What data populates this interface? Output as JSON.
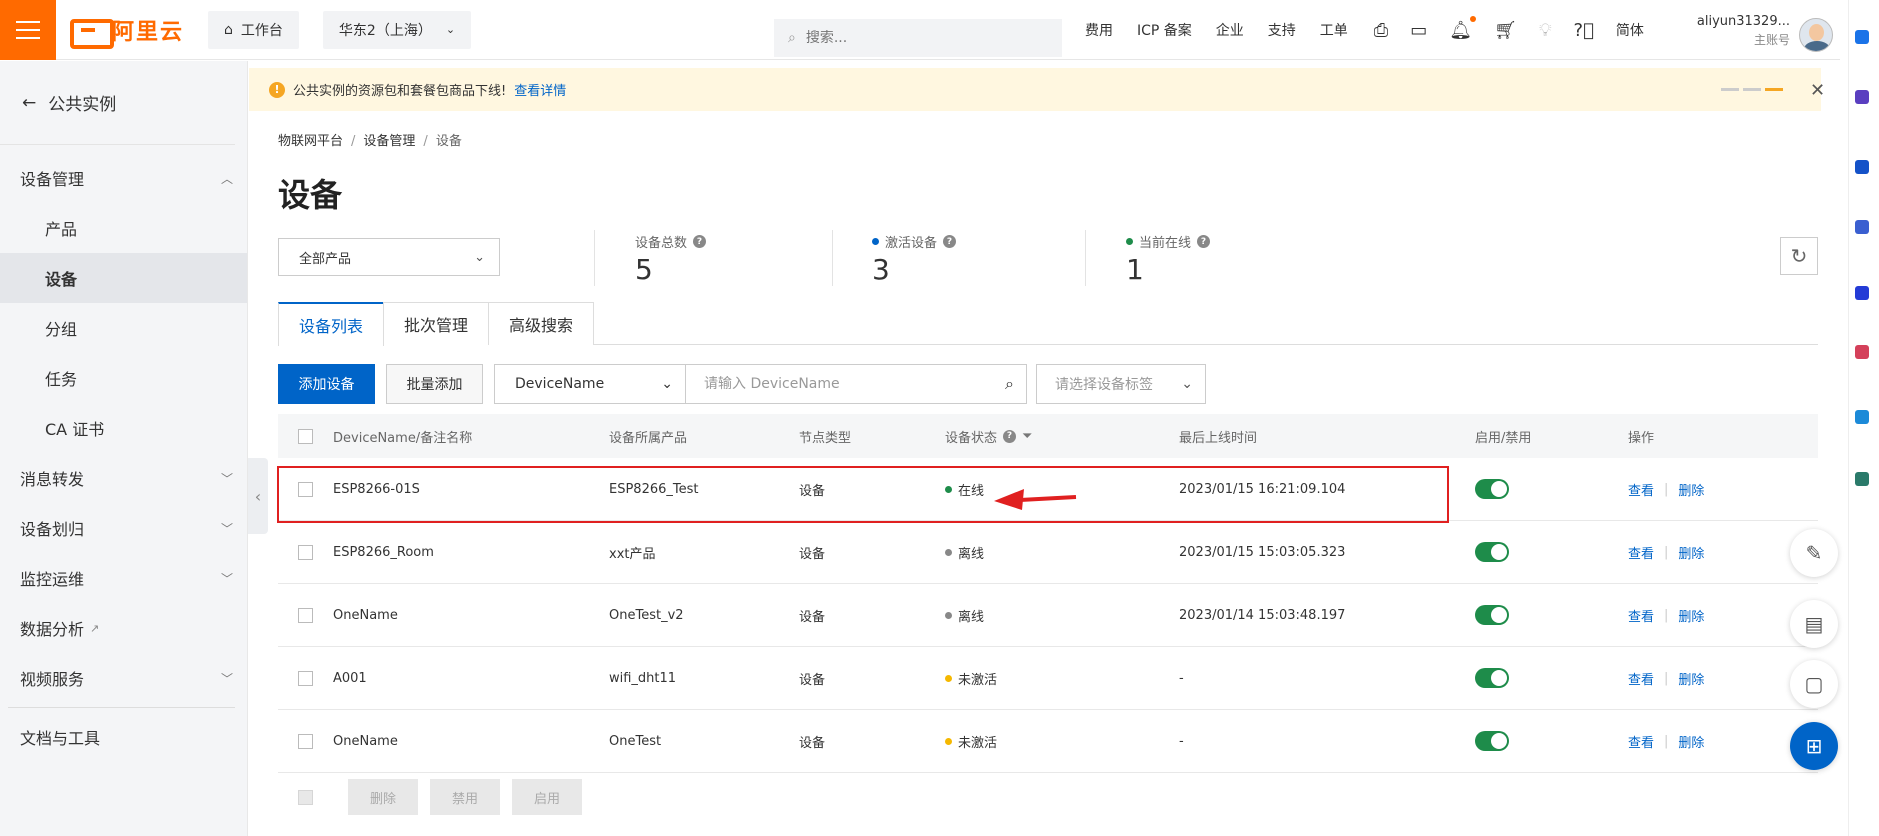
{
  "brand": {
    "logo_text": "阿里云",
    "accent": "#ff6a00"
  },
  "topbar": {
    "workbench": "工作台",
    "region": "华东2（上海）",
    "search_placeholder": "搜索...",
    "links": [
      "费用",
      "ICP 备案",
      "企业",
      "支持",
      "工单"
    ],
    "lang": "简体",
    "account_name": "aliyun31329...",
    "account_type": "主账号"
  },
  "sidebar": {
    "back_label": "公共实例",
    "groups": [
      {
        "label": "设备管理",
        "expanded": true,
        "items": [
          "产品",
          "设备",
          "分组",
          "任务",
          "CA 证书"
        ],
        "active": "设备"
      },
      {
        "label": "消息转发"
      },
      {
        "label": "设备划归"
      },
      {
        "label": "监控运维"
      },
      {
        "label": "数据分析"
      },
      {
        "label": "视频服务"
      }
    ],
    "docs": "文档与工具"
  },
  "notice": {
    "text": "公共实例的资源包和套餐包商品下线!",
    "link": "查看详情"
  },
  "breadcrumb": [
    "物联网平台",
    "设备管理",
    "设备"
  ],
  "page_title": "设备",
  "product_filter": "全部产品",
  "stats": [
    {
      "label": "设备总数",
      "value": "5",
      "dot": ""
    },
    {
      "label": "激活设备",
      "value": "3",
      "dot": "#0064c8"
    },
    {
      "label": "当前在线",
      "value": "1",
      "dot": "#1e8c4a"
    }
  ],
  "tabs": [
    "设备列表",
    "批次管理",
    "高级搜索"
  ],
  "toolbar": {
    "add": "添加设备",
    "batch_add": "批量添加",
    "field_select": "DeviceName",
    "search_placeholder": "请输入 DeviceName",
    "tag_placeholder": "请选择设备标签"
  },
  "table": {
    "headers": [
      "DeviceName/备注名称",
      "设备所属产品",
      "节点类型",
      "设备状态",
      "最后上线时间",
      "启用/禁用",
      "操作"
    ],
    "rows": [
      {
        "name": "ESP8266-01S",
        "product": "ESP8266_Test",
        "node": "设备",
        "status": "在线",
        "status_color": "#1e8c4a",
        "last_online": "2023/01/15 16:21:09.104"
      },
      {
        "name": "ESP8266_Room",
        "product": "xxt产品",
        "node": "设备",
        "status": "离线",
        "status_color": "#888888",
        "last_online": "2023/01/15 15:03:05.323"
      },
      {
        "name": "OneName",
        "product": "OneTest_v2",
        "node": "设备",
        "status": "离线",
        "status_color": "#888888",
        "last_online": "2023/01/14 15:03:48.197"
      },
      {
        "name": "A001",
        "product": "wifi_dht11",
        "node": "设备",
        "status": "未激活",
        "status_color": "#f5b800",
        "last_online": "-"
      },
      {
        "name": "OneName",
        "product": "OneTest",
        "node": "设备",
        "status": "未激活",
        "status_color": "#f5b800",
        "last_online": "-"
      }
    ],
    "op_view": "查看",
    "op_delete": "删除"
  },
  "footer": {
    "delete": "删除",
    "disable": "禁用",
    "enable": "启用"
  }
}
